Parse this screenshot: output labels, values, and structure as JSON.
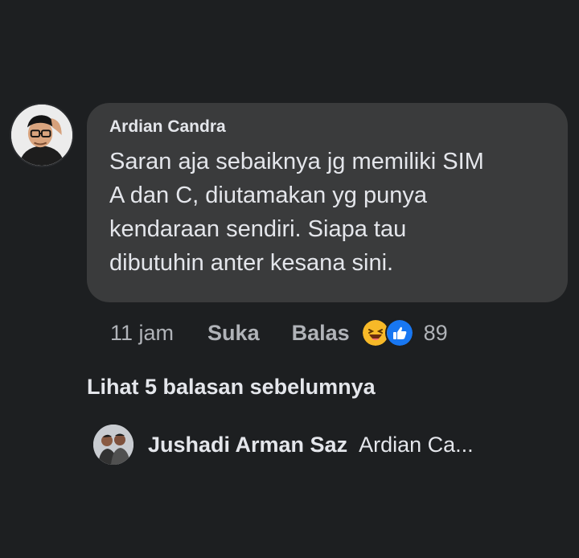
{
  "comment": {
    "author": "Ardian Candra",
    "text": "Saran aja sebaiknya jg memiliki SIM\nA dan C, diutamakan yg punya\nkendaraan sendiri. Siapa tau\ndibutuhin anter kesana sini.",
    "timestamp": "11 jam",
    "like_label": "Suka",
    "reply_label": "Balas",
    "reactions": [
      "haha-icon",
      "like-icon"
    ],
    "reaction_count": "89"
  },
  "view_previous_replies": "Lihat 5 balasan sebelumnya",
  "latest_reply": {
    "author": "Jushadi Arman Saz",
    "preview": "Ardian Ca..."
  },
  "colors": {
    "background": "#1d1f21",
    "bubble": "#3a3b3c",
    "primary_text": "#e4e6eb",
    "secondary_text": "#b0b3b8",
    "like_blue": "#1877f2",
    "haha_yellow": "#f7b928"
  }
}
